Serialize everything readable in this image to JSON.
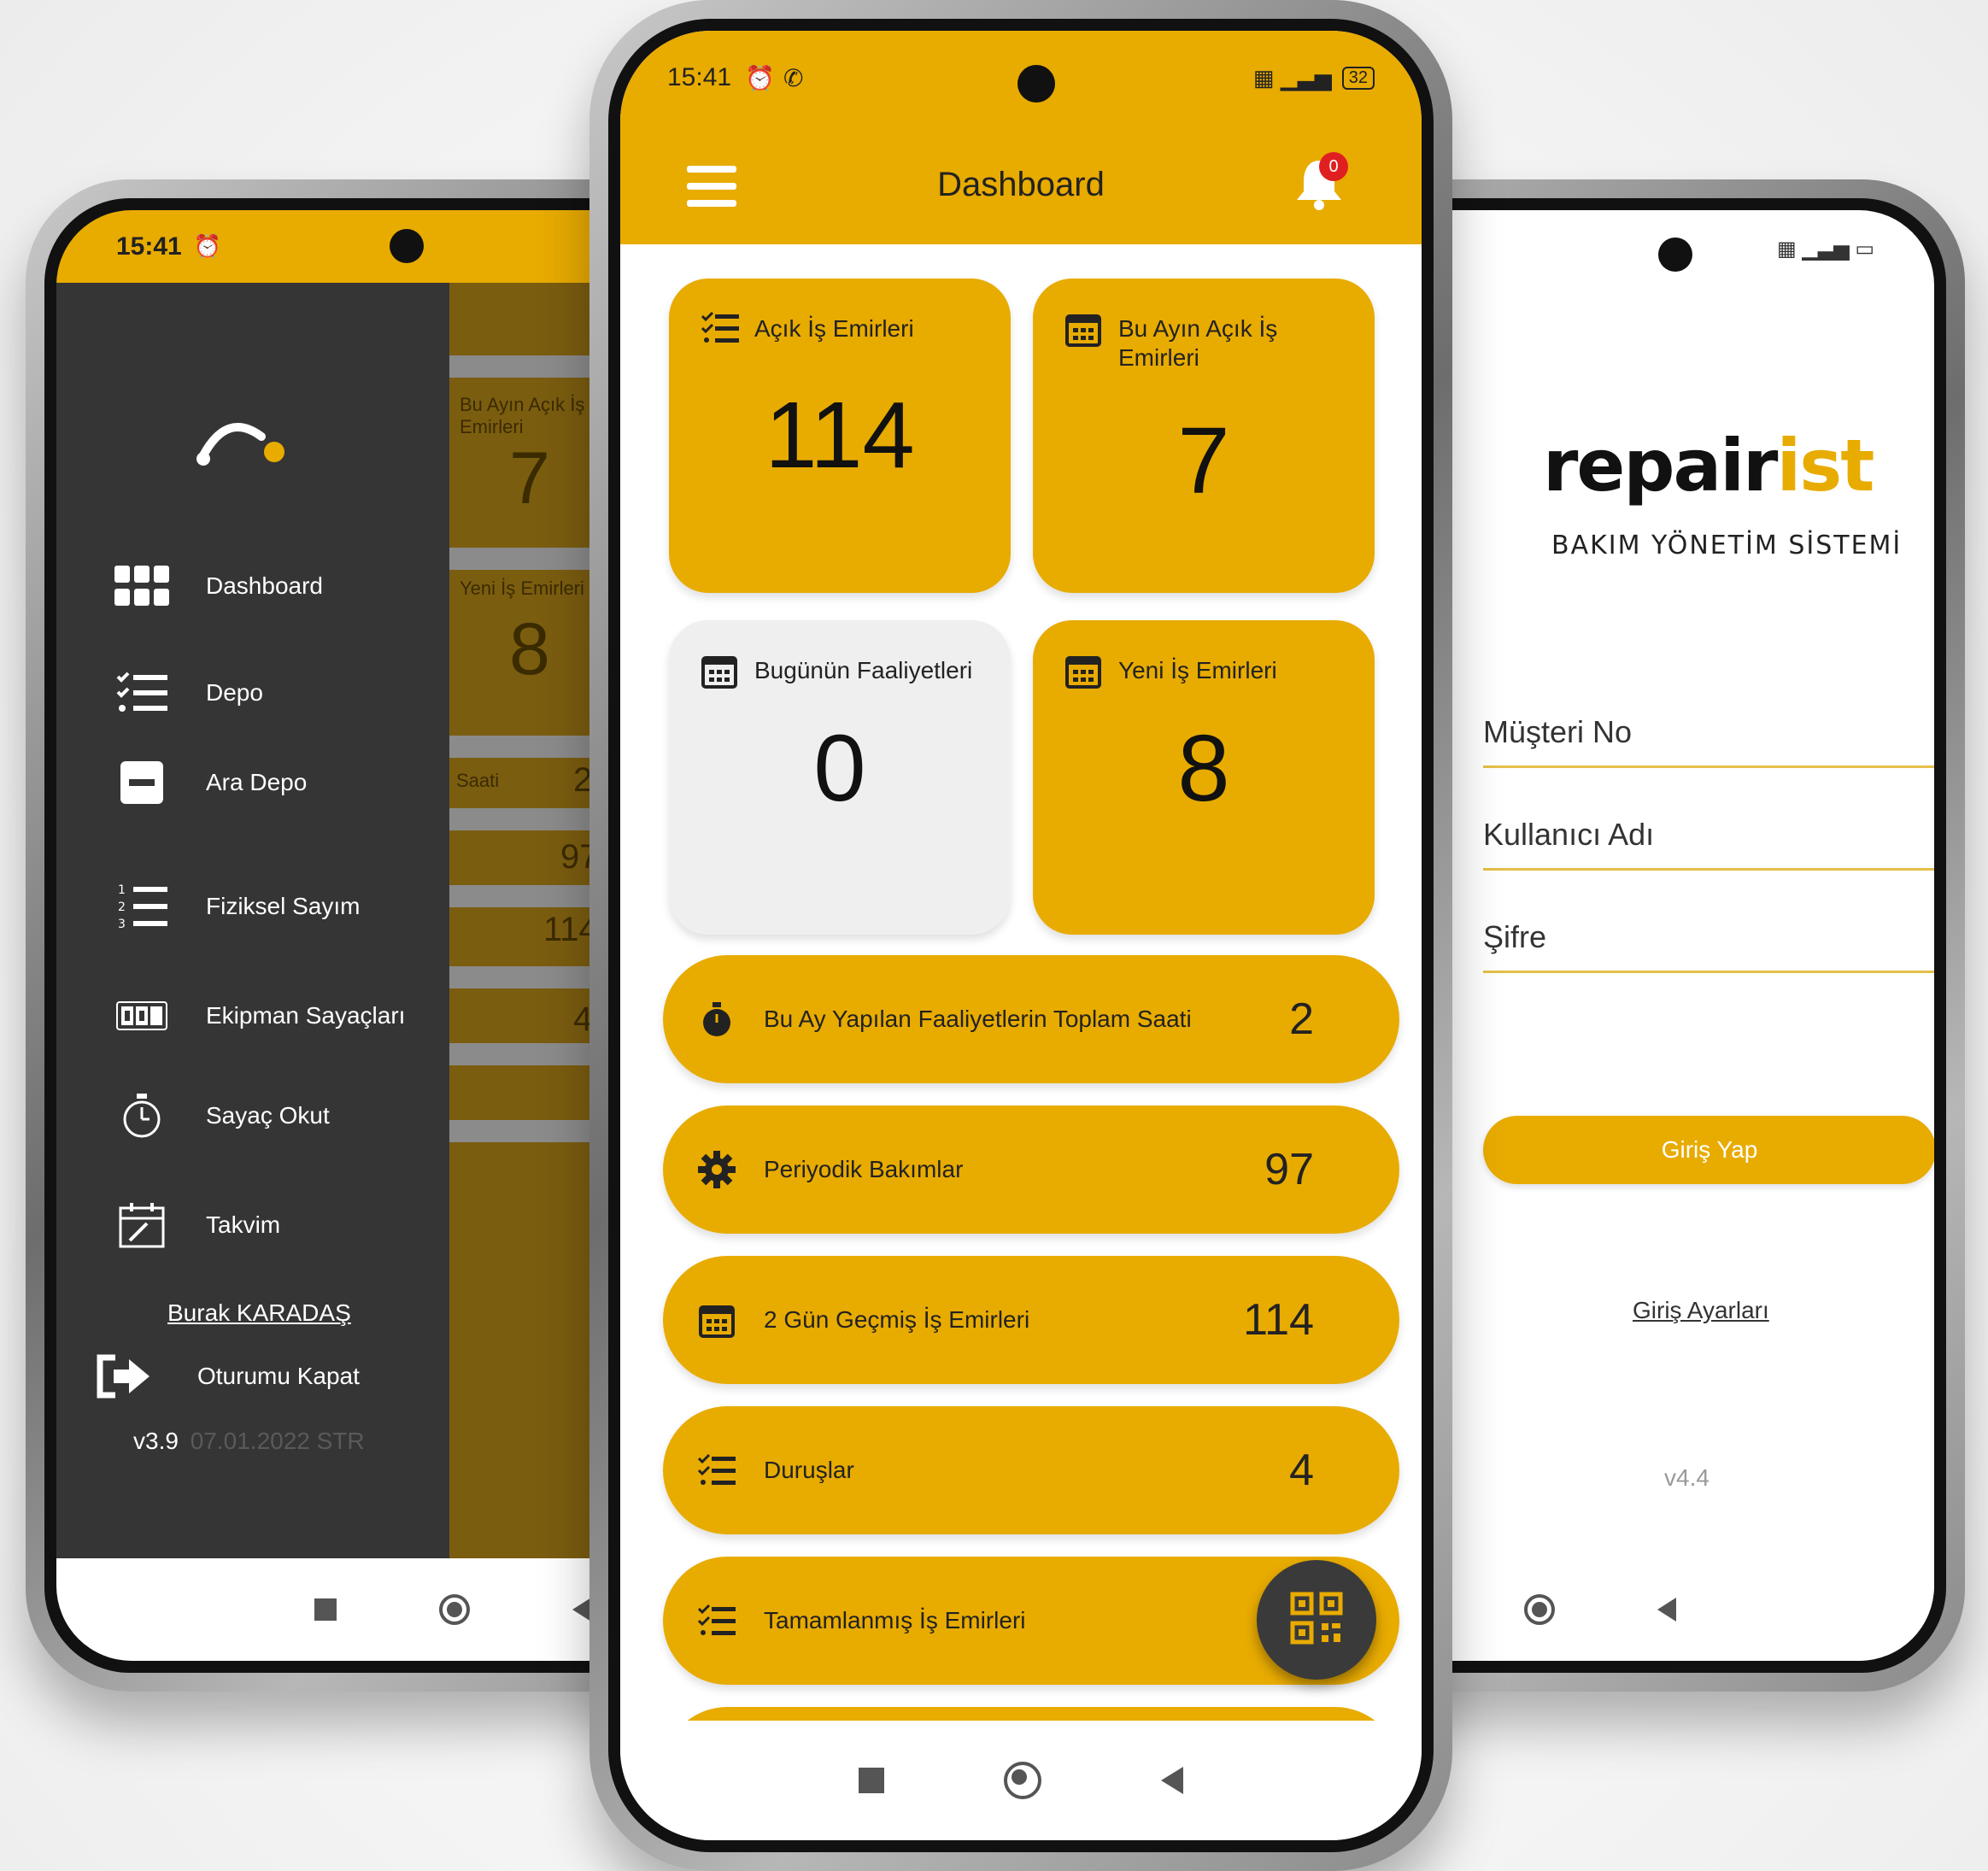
{
  "status": {
    "time": "15:41",
    "battery": "32"
  },
  "center": {
    "title": "Dashboard",
    "notification_count": "0",
    "cards": [
      {
        "label": "Açık İş Emirleri",
        "value": "114"
      },
      {
        "label": "Bu Ayın Açık İş Emirleri",
        "value": "7"
      },
      {
        "label": "Bugünün Faaliyetleri",
        "value": "0"
      },
      {
        "label": "Yeni İş Emirleri",
        "value": "8"
      }
    ],
    "rows": [
      {
        "label": "Bu Ay Yapılan Faaliyetlerin Toplam Saati",
        "value": "2",
        "icon": "stopwatch-icon"
      },
      {
        "label": "Periyodik Bakımlar",
        "value": "97",
        "icon": "gear-icon"
      },
      {
        "label": "2 Gün Geçmiş İş Emirleri",
        "value": "114",
        "icon": "calendar-icon"
      },
      {
        "label": "Duruşlar",
        "value": "4",
        "icon": "checklist-icon"
      },
      {
        "label": "Tamamlanmış İş Emirleri",
        "value": "",
        "icon": "checklist-icon"
      }
    ]
  },
  "left": {
    "menu": [
      {
        "label": "Dashboard",
        "icon": "grid-icon"
      },
      {
        "label": "Depo",
        "icon": "checklist-icon"
      },
      {
        "label": "Ara Depo",
        "icon": "minus-box-icon"
      },
      {
        "label": "Fiziksel Sayım",
        "icon": "numbered-list-icon"
      },
      {
        "label": "Ekipman Sayaçları",
        "icon": "counter-icon"
      },
      {
        "label": "Sayaç Okut",
        "icon": "stopwatch-icon"
      },
      {
        "label": "Takvim",
        "icon": "calendar-edit-icon"
      }
    ],
    "user": "Burak KARADAŞ",
    "logout": "Oturumu Kapat",
    "version": "v3.9",
    "version_date": "07.01.2022 STR",
    "behind": {
      "card1": "Bu Ayın Açık İş Emirleri",
      "card1_value": "7",
      "card2": "Yeni İş Emirleri",
      "card2_value": "8",
      "row1": "Saati",
      "row1_value": "2",
      "row2_value": "97",
      "row3_value": "114",
      "row4_value": "4"
    }
  },
  "right": {
    "brand_dark": "repair",
    "brand_light": "ist",
    "subtitle": "BAKIM YÖNETİM SİSTEMİ",
    "fields": [
      "Müşteri No",
      "Kullanıcı Adı",
      "Şifre"
    ],
    "login_button": "Giriş Yap",
    "settings_link": "Giriş Ayarları",
    "version": "v4.4"
  },
  "colors": {
    "accent": "#e8ab00",
    "drawer": "#353535",
    "muted_card": "#efefef"
  }
}
